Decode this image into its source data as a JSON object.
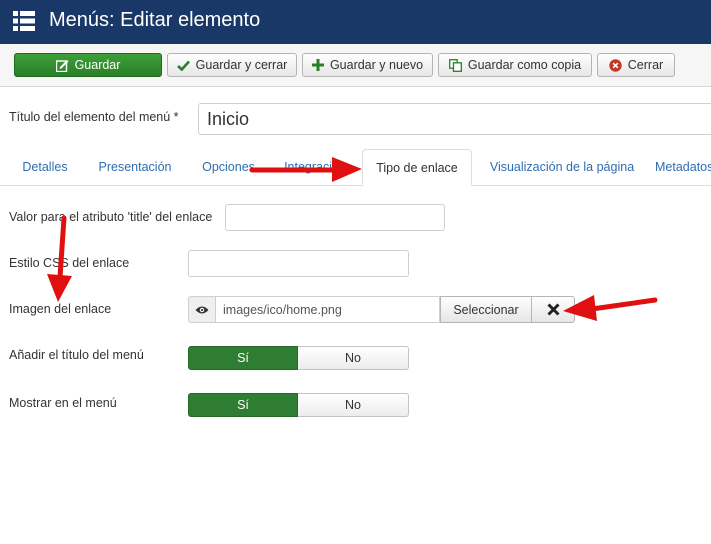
{
  "header": {
    "title": "Menús: Editar elemento",
    "menu_icon": "list-icon"
  },
  "toolbar": {
    "save_label": "Guardar",
    "save_close_label": "Guardar y cerrar",
    "save_new_label": "Guardar y nuevo",
    "save_copy_label": "Guardar como copia",
    "close_label": "Cerrar"
  },
  "form": {
    "title_label": "Título del elemento del menú *",
    "title_value": "Inicio"
  },
  "tabs": [
    {
      "label": "Detalles"
    },
    {
      "label": "Presentación"
    },
    {
      "label": "Opciones"
    },
    {
      "label": "Integración"
    },
    {
      "label": "Tipo de enlace",
      "active": true
    },
    {
      "label": "Visualización de la página"
    },
    {
      "label": "Metadatos"
    }
  ],
  "fields": {
    "title_attr_label": "Valor para el atributo 'title' del enlace",
    "title_attr_value": "",
    "css_label": "Estilo CSS del enlace",
    "css_value": "",
    "image_label": "Imagen del enlace",
    "image_value": "images/ico/home.png",
    "image_select_label": "Seleccionar",
    "add_title_label": "Añadir el título del menú",
    "show_in_menu_label": "Mostrar en el menú"
  },
  "toggles": {
    "add_title": {
      "yes": "Sí",
      "no": "No",
      "selected": "yes"
    },
    "show_in_menu": {
      "yes": "Sí",
      "no": "No",
      "selected": "yes"
    }
  },
  "colors": {
    "header_bg": "#1a3867",
    "save_green": "#2f7d32",
    "tab_link": "#2f6db0",
    "annotation_arrow": "#e01010"
  }
}
